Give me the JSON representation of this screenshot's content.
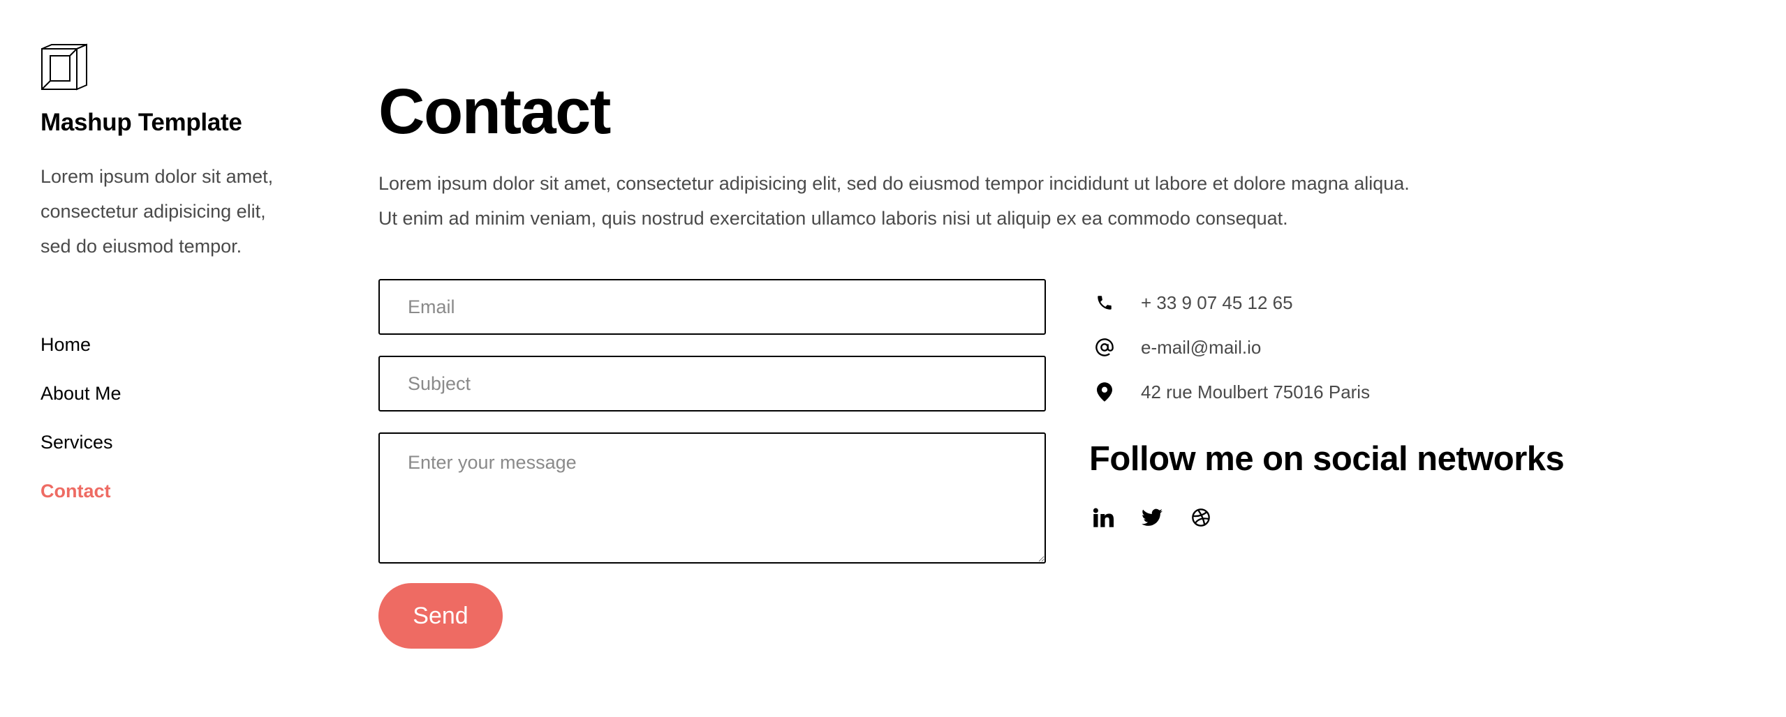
{
  "sidebar": {
    "logo_icon": "isometric-cube-logo",
    "brand_title": "Mashup Template",
    "brand_desc_lines": [
      "Lorem ipsum dolor sit amet,",
      "consectetur adipisicing elit,",
      "sed do eiusmod tempor."
    ],
    "nav": [
      {
        "label": "Home",
        "active": false
      },
      {
        "label": "About Me",
        "active": false
      },
      {
        "label": "Services",
        "active": false
      },
      {
        "label": "Contact",
        "active": true
      }
    ]
  },
  "main": {
    "title": "Contact",
    "intro_lines": [
      "Lorem ipsum dolor sit amet, consectetur adipisicing elit, sed do eiusmod tempor incididunt ut labore et dolore magna aliqua.",
      "Ut enim ad minim veniam, quis nostrud exercitation ullamco laboris nisi ut aliquip ex ea commodo consequat."
    ],
    "form": {
      "email_placeholder": "Email",
      "email_value": "",
      "subject_placeholder": "Subject",
      "subject_value": "",
      "message_placeholder": "Enter your message",
      "message_value": "",
      "send_label": "Send"
    },
    "contact_info": [
      {
        "icon": "phone-icon",
        "text": "+ 33 9 07 45 12 65"
      },
      {
        "icon": "at-sign-icon",
        "text": "e-mail@mail.io"
      },
      {
        "icon": "map-pin-icon",
        "text": "42 rue Moulbert 75016 Paris"
      }
    ],
    "follow_title": "Follow me on social networks",
    "socials": [
      {
        "icon": "linkedin-icon"
      },
      {
        "icon": "twitter-icon"
      },
      {
        "icon": "dribbble-icon"
      }
    ]
  },
  "colors": {
    "accent": "#ee6b63",
    "text": "#000000",
    "muted_text": "#4a4a4a",
    "placeholder": "#8a8a8a"
  }
}
